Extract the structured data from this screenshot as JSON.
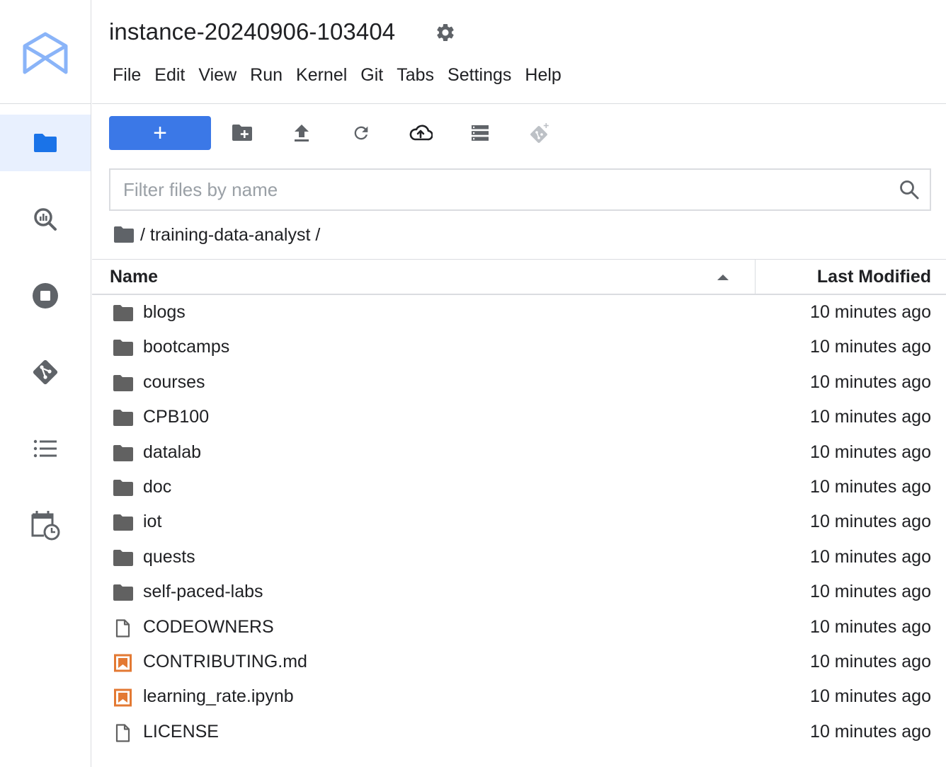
{
  "header": {
    "instance_title": "instance-20240906-103404"
  },
  "menu": [
    "File",
    "Edit",
    "View",
    "Run",
    "Kernel",
    "Git",
    "Tabs",
    "Settings",
    "Help"
  ],
  "toolbar": {
    "new_label": "+",
    "buttons": [
      "new-folder-icon",
      "upload-icon",
      "refresh-icon",
      "cloud-upload-icon",
      "storage-icon",
      "git-clone-icon"
    ]
  },
  "sidebar": {
    "items": [
      "file-browser-icon",
      "data-explorer-icon",
      "running-terminals-icon",
      "git-icon",
      "table-of-contents-icon",
      "scheduler-icon"
    ],
    "active": "file-browser-icon"
  },
  "filter": {
    "placeholder": "Filter files by name",
    "value": ""
  },
  "breadcrumb": {
    "path": "/ training-data-analyst /"
  },
  "columns": {
    "name": "Name",
    "modified": "Last Modified"
  },
  "files": [
    {
      "name": "blogs",
      "type": "folder",
      "modified": "10 minutes ago"
    },
    {
      "name": "bootcamps",
      "type": "folder",
      "modified": "10 minutes ago"
    },
    {
      "name": "courses",
      "type": "folder",
      "modified": "10 minutes ago"
    },
    {
      "name": "CPB100",
      "type": "folder",
      "modified": "10 minutes ago"
    },
    {
      "name": "datalab",
      "type": "folder",
      "modified": "10 minutes ago"
    },
    {
      "name": "doc",
      "type": "folder",
      "modified": "10 minutes ago"
    },
    {
      "name": "iot",
      "type": "folder",
      "modified": "10 minutes ago"
    },
    {
      "name": "quests",
      "type": "folder",
      "modified": "10 minutes ago"
    },
    {
      "name": "self-paced-labs",
      "type": "folder",
      "modified": "10 minutes ago"
    },
    {
      "name": "CODEOWNERS",
      "type": "file",
      "modified": "10 minutes ago"
    },
    {
      "name": "CONTRIBUTING.md",
      "type": "markdown",
      "modified": "10 minutes ago"
    },
    {
      "name": "learning_rate.ipynb",
      "type": "notebook",
      "modified": "10 minutes ago"
    },
    {
      "name": "LICENSE",
      "type": "file",
      "modified": "10 minutes ago"
    }
  ],
  "colors": {
    "accent": "#3b78e7",
    "active_bg": "#e8f0fe",
    "folder_icon": "#616161",
    "notebook_icon": "#e37933",
    "logo": "#8ab4f8",
    "border": "#dadce0"
  }
}
